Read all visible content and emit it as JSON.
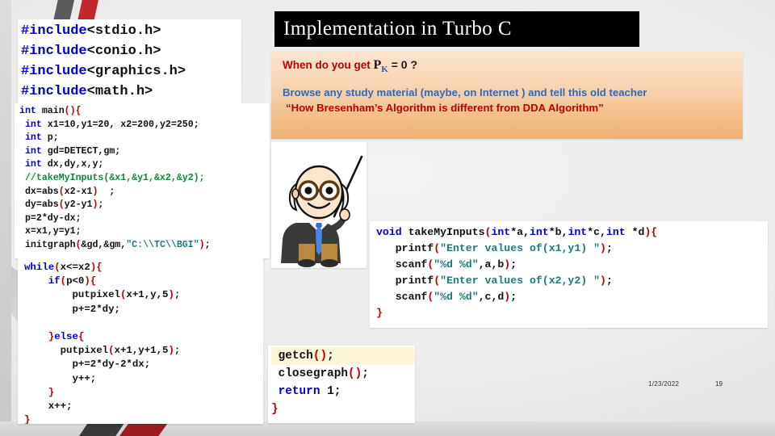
{
  "slide": {
    "title": "Implementation in Turbo C",
    "footer_date": "1/23/2022",
    "footer_number": "19"
  },
  "callout": {
    "question_prefix": "When do you get ",
    "question_symbol": "P",
    "question_subscript": "K",
    "question_suffix": " = 0 ?",
    "line_blue": "Browse any study material (maybe, on Internet )   and tell this old teacher",
    "line_red": "“How Bresenham’s Algorithm is different from DDA Algorithm”"
  },
  "code_includes": {
    "name": "includes-block",
    "lines": [
      "#include<stdio.h>",
      "#include<conio.h>",
      "#include<graphics.h>",
      "#include<math.h>"
    ]
  },
  "code_main": {
    "name": "main-block",
    "lines": [
      "int main(){",
      " int x1=10,y1=20, x2=200,y2=250;",
      " int p;",
      " int gd=DETECT,gm;",
      " int dx,dy,x,y;",
      " //takeMyInputs(&x1,&y1,&x2,&y2);",
      " dx=abs(x2-x1)  ;",
      " dy=abs(y2-y1);",
      " p=2*dy-dx;",
      " x=x1,y=y1;",
      " initgraph(&gd,&gm,\"C:\\\\TC\\\\BGI\");"
    ]
  },
  "code_while": {
    "name": "while-loop-block",
    "lines": [
      "while(x<=x2){",
      "    if(p<0){",
      "        putpixel(x+1,y,5);",
      "        p+=2*dy;",
      "",
      "    }else{",
      "      putpixel(x+1,y+1,5);",
      "        p+=2*dy-2*dx;",
      "        y++;",
      "    }",
      "    x++;",
      "}"
    ]
  },
  "code_func": {
    "name": "takemyinputs-function-block",
    "lines": [
      "void takeMyInputs(int*a,int*b,int*c,int *d){",
      "   printf(\"Enter values of(x1,y1) \");",
      "   scanf(\"%d %d\",a,b);",
      "   printf(\"Enter values of(x2,y2) \");",
      "   scanf(\"%d %d\",c,d);",
      "}"
    ]
  },
  "code_tail": {
    "name": "cleanup-block",
    "lines": [
      " getch();",
      " closegraph();",
      " return 1;",
      "}"
    ]
  },
  "teacher": {
    "alt": "cartoon old teacher with pointer stick"
  },
  "colors": {
    "accent_red": "#c00000",
    "accent_blue": "#2b6cb8",
    "keyword_blue": "#0000c8",
    "string_teal": "#1b7b7b",
    "comment_green": "#0b8a3c",
    "title_bg": "#000000",
    "callout_top": "#fbe3cd",
    "callout_bottom": "#eeb173",
    "chevron_gray": "#5a5a5a",
    "chevron_red": "#c1272d"
  }
}
